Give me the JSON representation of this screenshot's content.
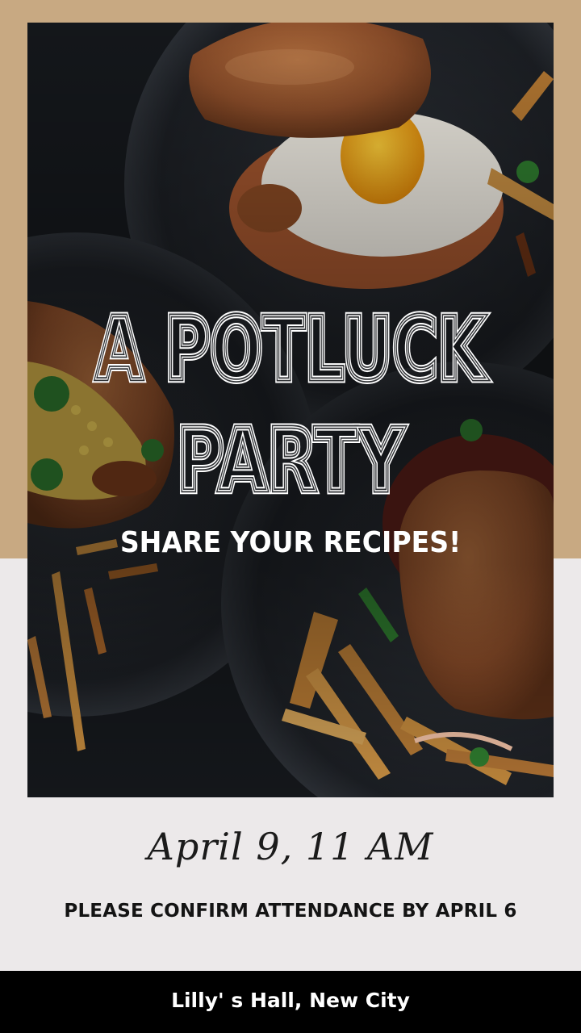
{
  "poster": {
    "headline_line1": "A POTLUCK",
    "headline_line2": "PARTY",
    "tagline": "SHARE YOUR RECIPES!",
    "date_time": "April 9, 11 AM",
    "confirm_note": "PLEASE CONFIRM ATTENDANCE BY APRIL 6",
    "venue": "Lilly' s Hall, New City"
  },
  "colors": {
    "tan_band": "#c8a982",
    "page_background": "#ece9ea",
    "footer_background": "#000000",
    "headline_text": "#ffffff"
  },
  "image": {
    "subject": "food-photo-burgers-hotdog-fries"
  }
}
